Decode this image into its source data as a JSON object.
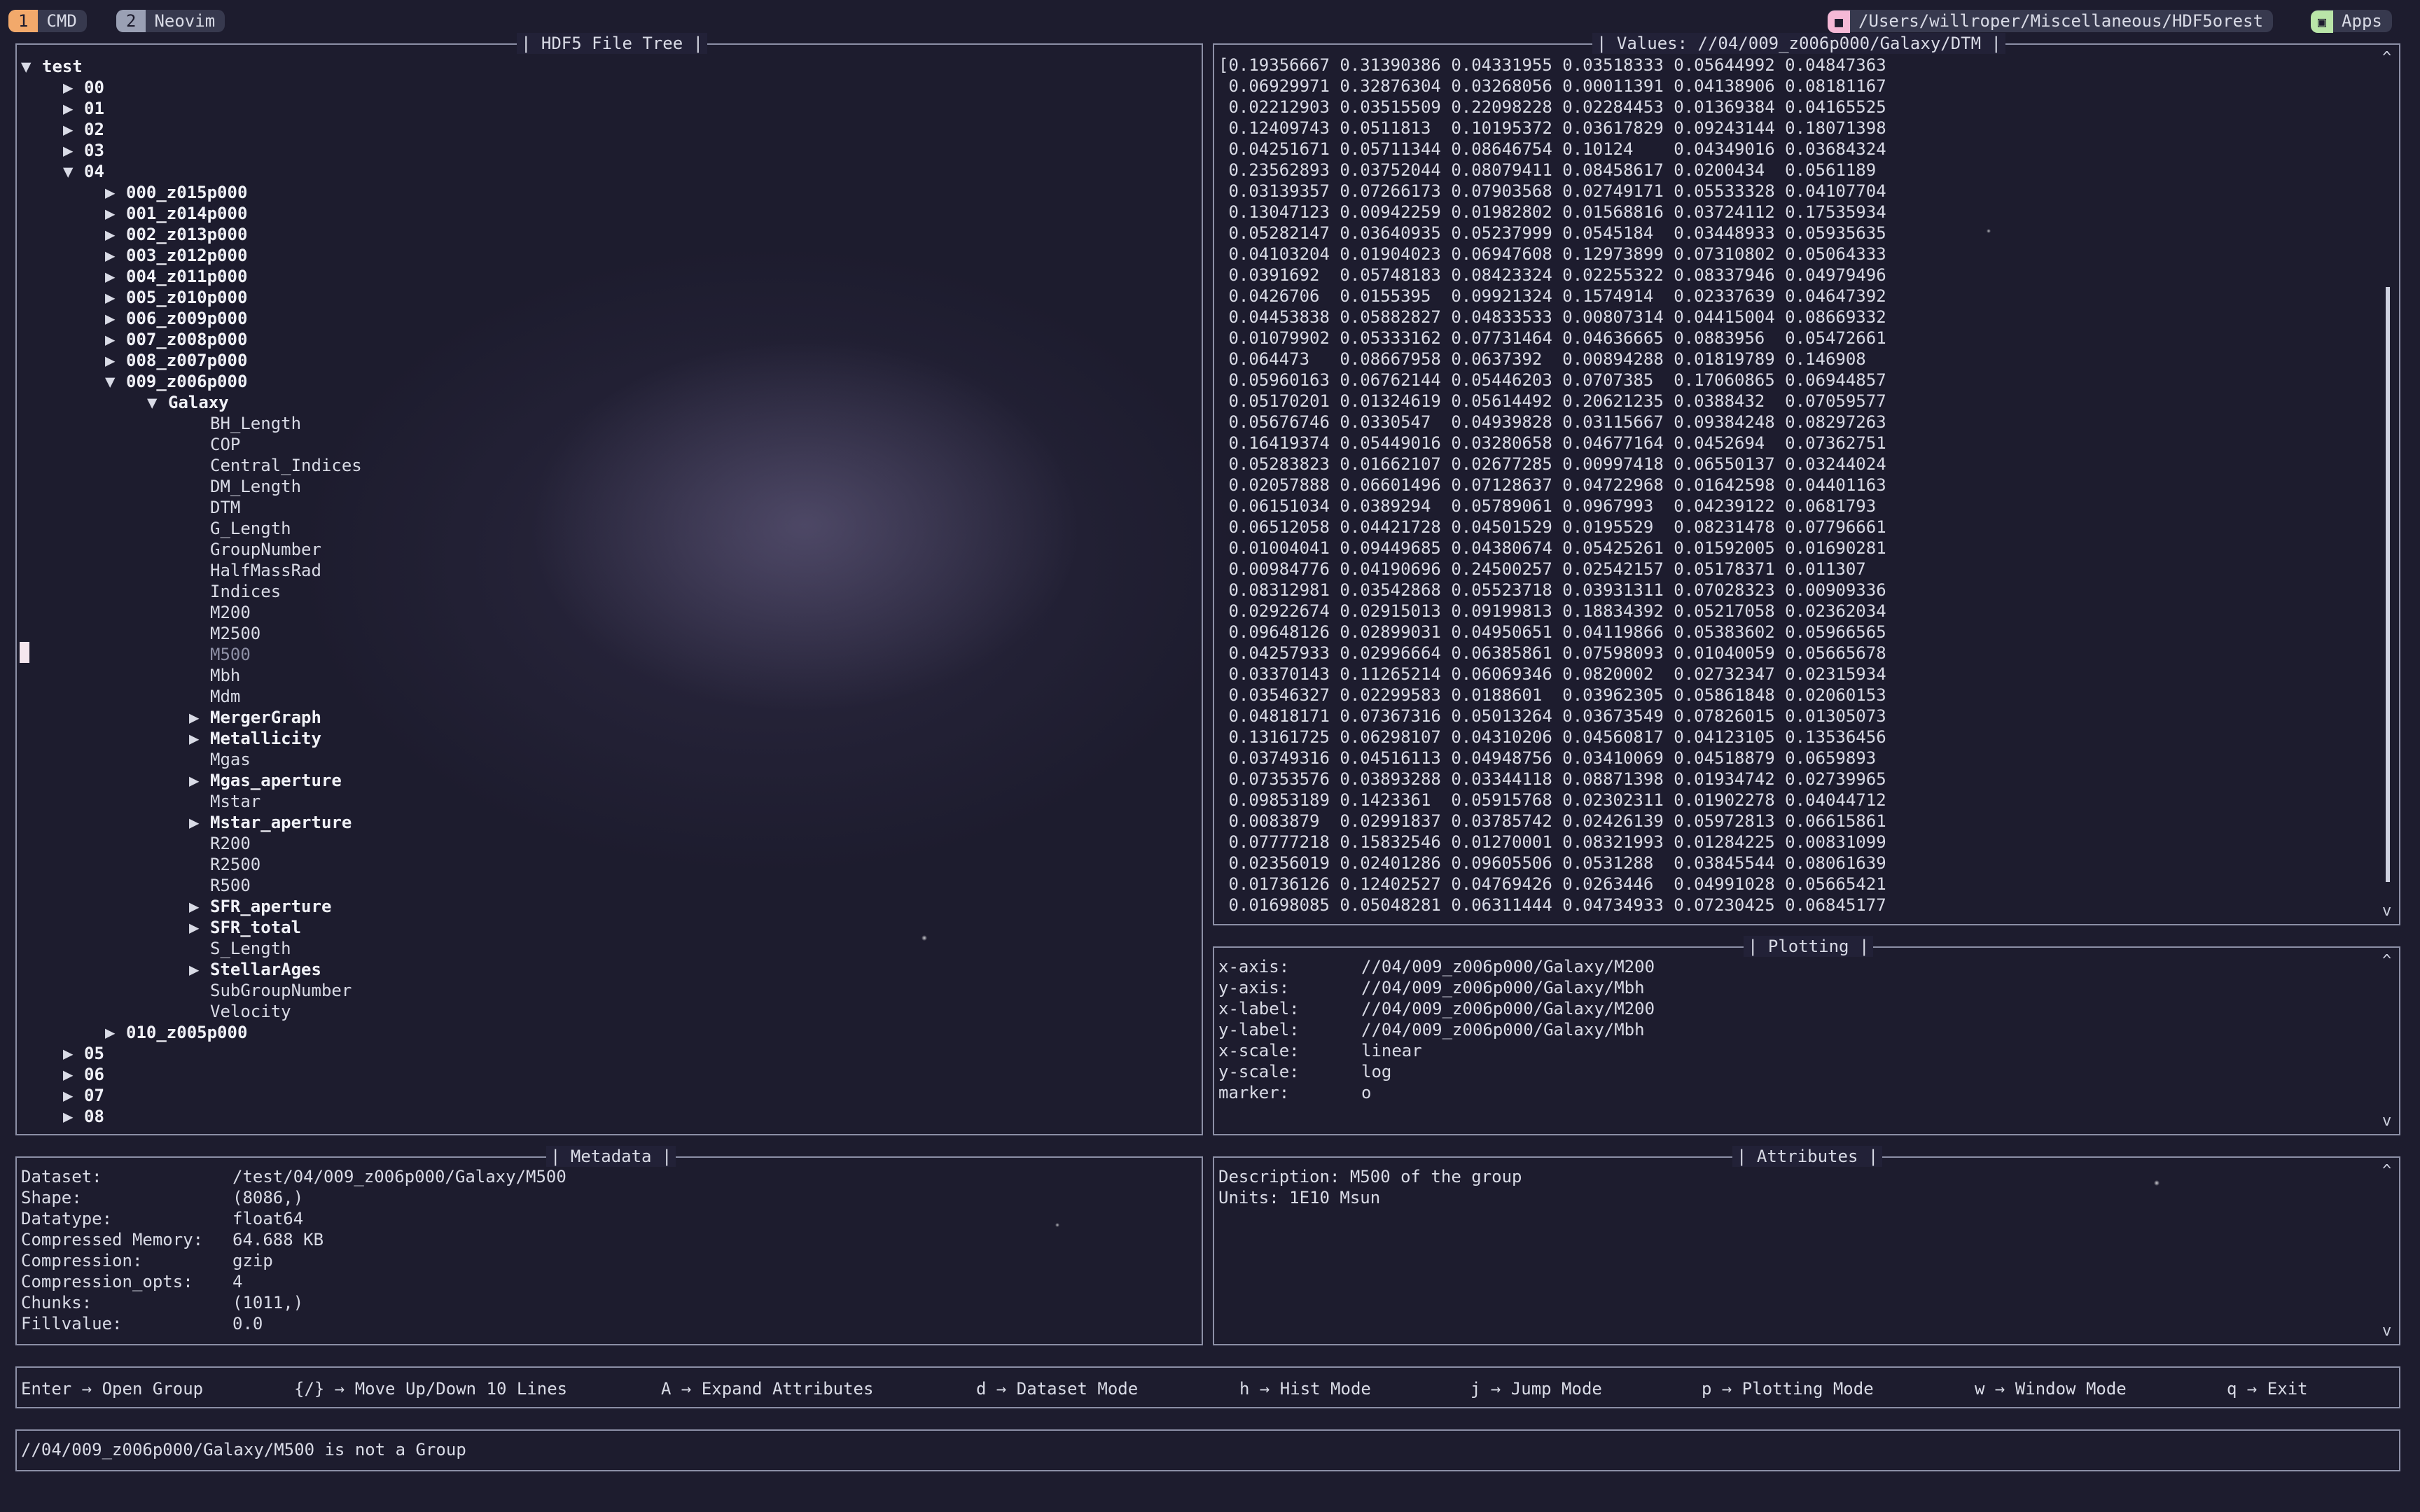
{
  "topbar": {
    "workspaces": [
      {
        "num": "1",
        "label": "CMD"
      },
      {
        "num": "2",
        "label": "Neovim"
      }
    ],
    "path": "/Users/willroper/Miscellaneous/HDF5orest",
    "apps": "Apps"
  },
  "tree_panel": {
    "title": "| HDF5 File Tree |",
    "rows": [
      {
        "indent": 0,
        "arrow": "▼",
        "label": "test",
        "bold": true
      },
      {
        "indent": 2,
        "arrow": "▶",
        "label": "00",
        "bold": true
      },
      {
        "indent": 2,
        "arrow": "▶",
        "label": "01",
        "bold": true
      },
      {
        "indent": 2,
        "arrow": "▶",
        "label": "02",
        "bold": true
      },
      {
        "indent": 2,
        "arrow": "▶",
        "label": "03",
        "bold": true
      },
      {
        "indent": 2,
        "arrow": "▼",
        "label": "04",
        "bold": true
      },
      {
        "indent": 4,
        "arrow": "▶",
        "label": "000_z015p000",
        "bold": true
      },
      {
        "indent": 4,
        "arrow": "▶",
        "label": "001_z014p000",
        "bold": true
      },
      {
        "indent": 4,
        "arrow": "▶",
        "label": "002_z013p000",
        "bold": true
      },
      {
        "indent": 4,
        "arrow": "▶",
        "label": "003_z012p000",
        "bold": true
      },
      {
        "indent": 4,
        "arrow": "▶",
        "label": "004_z011p000",
        "bold": true
      },
      {
        "indent": 4,
        "arrow": "▶",
        "label": "005_z010p000",
        "bold": true
      },
      {
        "indent": 4,
        "arrow": "▶",
        "label": "006_z009p000",
        "bold": true
      },
      {
        "indent": 4,
        "arrow": "▶",
        "label": "007_z008p000",
        "bold": true
      },
      {
        "indent": 4,
        "arrow": "▶",
        "label": "008_z007p000",
        "bold": true
      },
      {
        "indent": 4,
        "arrow": "▼",
        "label": "009_z006p000",
        "bold": true
      },
      {
        "indent": 6,
        "arrow": "▼",
        "label": "Galaxy",
        "bold": true
      },
      {
        "indent": 8,
        "arrow": "",
        "label": "BH_Length"
      },
      {
        "indent": 8,
        "arrow": "",
        "label": "COP"
      },
      {
        "indent": 8,
        "arrow": "",
        "label": "Central_Indices"
      },
      {
        "indent": 8,
        "arrow": "",
        "label": "DM_Length"
      },
      {
        "indent": 8,
        "arrow": "",
        "label": "DTM"
      },
      {
        "indent": 8,
        "arrow": "",
        "label": "G_Length"
      },
      {
        "indent": 8,
        "arrow": "",
        "label": "GroupNumber"
      },
      {
        "indent": 8,
        "arrow": "",
        "label": "HalfMassRad"
      },
      {
        "indent": 8,
        "arrow": "",
        "label": "Indices"
      },
      {
        "indent": 8,
        "arrow": "",
        "label": "M200"
      },
      {
        "indent": 8,
        "arrow": "",
        "label": "M2500"
      },
      {
        "indent": 8,
        "arrow": "",
        "label": "M500",
        "selected": true
      },
      {
        "indent": 8,
        "arrow": "",
        "label": "Mbh"
      },
      {
        "indent": 8,
        "arrow": "",
        "label": "Mdm"
      },
      {
        "indent": 8,
        "arrow": "▶",
        "label": "MergerGraph",
        "bold": true
      },
      {
        "indent": 8,
        "arrow": "▶",
        "label": "Metallicity",
        "bold": true
      },
      {
        "indent": 8,
        "arrow": "",
        "label": "Mgas"
      },
      {
        "indent": 8,
        "arrow": "▶",
        "label": "Mgas_aperture",
        "bold": true
      },
      {
        "indent": 8,
        "arrow": "",
        "label": "Mstar"
      },
      {
        "indent": 8,
        "arrow": "▶",
        "label": "Mstar_aperture",
        "bold": true
      },
      {
        "indent": 8,
        "arrow": "",
        "label": "R200"
      },
      {
        "indent": 8,
        "arrow": "",
        "label": "R2500"
      },
      {
        "indent": 8,
        "arrow": "",
        "label": "R500"
      },
      {
        "indent": 8,
        "arrow": "▶",
        "label": "SFR_aperture",
        "bold": true
      },
      {
        "indent": 8,
        "arrow": "▶",
        "label": "SFR_total",
        "bold": true
      },
      {
        "indent": 8,
        "arrow": "",
        "label": "S_Length"
      },
      {
        "indent": 8,
        "arrow": "▶",
        "label": "StellarAges",
        "bold": true
      },
      {
        "indent": 8,
        "arrow": "",
        "label": "SubGroupNumber"
      },
      {
        "indent": 8,
        "arrow": "",
        "label": "Velocity"
      },
      {
        "indent": 4,
        "arrow": "▶",
        "label": "010_z005p000",
        "bold": true
      },
      {
        "indent": 2,
        "arrow": "▶",
        "label": "05",
        "bold": true
      },
      {
        "indent": 2,
        "arrow": "▶",
        "label": "06",
        "bold": true
      },
      {
        "indent": 2,
        "arrow": "▶",
        "label": "07",
        "bold": true
      },
      {
        "indent": 2,
        "arrow": "▶",
        "label": "08",
        "bold": true
      }
    ]
  },
  "values_panel": {
    "title": "| Values: //04/009_z006p000/Galaxy/DTM |",
    "lines": [
      "[0.19356667 0.31390386 0.04331955 0.03518333 0.05644992 0.04847363",
      " 0.06929971 0.32876304 0.03268056 0.00011391 0.04138906 0.08181167",
      " 0.02212903 0.03515509 0.22098228 0.02284453 0.01369384 0.04165525",
      " 0.12409743 0.0511813  0.10195372 0.03617829 0.09243144 0.18071398",
      " 0.04251671 0.05711344 0.08646754 0.10124    0.04349016 0.03684324",
      " 0.23562893 0.03752044 0.08079411 0.08458617 0.0200434  0.0561189",
      " 0.03139357 0.07266173 0.07903568 0.02749171 0.05533328 0.04107704",
      " 0.13047123 0.00942259 0.01982802 0.01568816 0.03724112 0.17535934",
      " 0.05282147 0.03640935 0.05237999 0.0545184  0.03448933 0.05935635",
      " 0.04103204 0.01904023 0.06947608 0.12973899 0.07310802 0.05064333",
      " 0.0391692  0.05748183 0.08423324 0.02255322 0.08337946 0.04979496",
      " 0.0426706  0.0155395  0.09921324 0.1574914  0.02337639 0.04647392",
      " 0.04453838 0.05882827 0.04833533 0.00807314 0.04415004 0.08669332",
      " 0.01079902 0.05333162 0.07731464 0.04636665 0.0883956  0.05472661",
      " 0.064473   0.08667958 0.0637392  0.00894288 0.01819789 0.146908",
      " 0.05960163 0.06762144 0.05446203 0.0707385  0.17060865 0.06944857",
      " 0.05170201 0.01324619 0.05614492 0.20621235 0.0388432  0.07059577",
      " 0.05676746 0.0330547  0.04939828 0.03115667 0.09384248 0.08297263",
      " 0.16419374 0.05449016 0.03280658 0.04677164 0.0452694  0.07362751",
      " 0.05283823 0.01662107 0.02677285 0.00997418 0.06550137 0.03244024",
      " 0.02057888 0.06601496 0.07128637 0.04722968 0.01642598 0.04401163",
      " 0.06151034 0.0389294  0.05789061 0.0967993  0.04239122 0.0681793",
      " 0.06512058 0.04421728 0.04501529 0.0195529  0.08231478 0.07796661",
      " 0.01004041 0.09449685 0.04380674 0.05425261 0.01592005 0.01690281",
      " 0.00984776 0.04190696 0.24500257 0.02542157 0.05178371 0.011307",
      " 0.08312981 0.03542868 0.05523718 0.03931311 0.07028323 0.00909336",
      " 0.02922674 0.02915013 0.09199813 0.18834392 0.05217058 0.02362034",
      " 0.09648126 0.02899031 0.04950651 0.04119866 0.05383602 0.05966565",
      " 0.04257933 0.02996664 0.06385861 0.07598093 0.01040059 0.05665678",
      " 0.03370143 0.11265214 0.06069346 0.0820002  0.02732347 0.02315934",
      " 0.03546327 0.02299583 0.0188601  0.03962305 0.05861848 0.02060153",
      " 0.04818171 0.07367316 0.05013264 0.03673549 0.07826015 0.01305073",
      " 0.13161725 0.06298107 0.04310206 0.04560817 0.04123105 0.13536456",
      " 0.03749316 0.04516113 0.04948756 0.03410069 0.04518879 0.0659893",
      " 0.07353576 0.03893288 0.03344118 0.08871398 0.01934742 0.02739965",
      " 0.09853189 0.1423361  0.05915768 0.02302311 0.01902278 0.04044712",
      " 0.0083879  0.02991837 0.03785742 0.02426139 0.05972813 0.06615861",
      " 0.07777218 0.15832546 0.01270001 0.08321993 0.01284225 0.00831099",
      " 0.02356019 0.02401286 0.09605506 0.0531288  0.03845544 0.08061639",
      " 0.01736126 0.12402527 0.04769426 0.0263446  0.04991028 0.05665421",
      " 0.01698085 0.05048281 0.06311444 0.04734933 0.07230425 0.06845177"
    ],
    "scroll_down": "v",
    "scroll_up": "^"
  },
  "plotting_panel": {
    "title": "| Plotting |",
    "rows": [
      {
        "key": "x-axis:",
        "value": "//04/009_z006p000/Galaxy/M200"
      },
      {
        "key": "y-axis:",
        "value": "//04/009_z006p000/Galaxy/Mbh"
      },
      {
        "key": "x-label:",
        "value": "//04/009_z006p000/Galaxy/M200"
      },
      {
        "key": "y-label:",
        "value": "//04/009_z006p000/Galaxy/Mbh"
      },
      {
        "key": "x-scale:",
        "value": "linear"
      },
      {
        "key": "y-scale:",
        "value": "log"
      },
      {
        "key": "marker:",
        "value": "o"
      }
    ]
  },
  "metadata_panel": {
    "title": "| Metadata |",
    "rows": [
      {
        "key": "Dataset:",
        "value": "/test/04/009_z006p000/Galaxy/M500"
      },
      {
        "key": "Shape:",
        "value": "(8086,)"
      },
      {
        "key": "Datatype:",
        "value": "float64"
      },
      {
        "key": "Compressed Memory:",
        "value": "64.688 KB"
      },
      {
        "key": "Compression:",
        "value": "gzip"
      },
      {
        "key": "Compression_opts:",
        "value": "4"
      },
      {
        "key": "Chunks:",
        "value": "(1011,)"
      },
      {
        "key": "Fillvalue:",
        "value": "0.0"
      }
    ]
  },
  "attributes_panel": {
    "title": "| Attributes |",
    "lines": [
      "Description: M500 of the group",
      "Units: 1E10 Msun"
    ]
  },
  "keybindings": [
    "Enter → Open Group",
    "{/} → Move Up/Down 10 Lines",
    "A → Expand Attributes",
    "d → Dataset Mode",
    "h → Hist Mode",
    "j → Jump Mode",
    "p → Plotting Mode",
    "w → Window Mode",
    "q → Exit"
  ],
  "status": "//04/009_z006p000/Galaxy/M500 is not a Group",
  "colors": {
    "accent_orange": "#f2a96b",
    "accent_pink": "#f5b8d6",
    "accent_green": "#b9e5a8",
    "border": "#8c8fa6",
    "background": "#1d1c2e"
  }
}
